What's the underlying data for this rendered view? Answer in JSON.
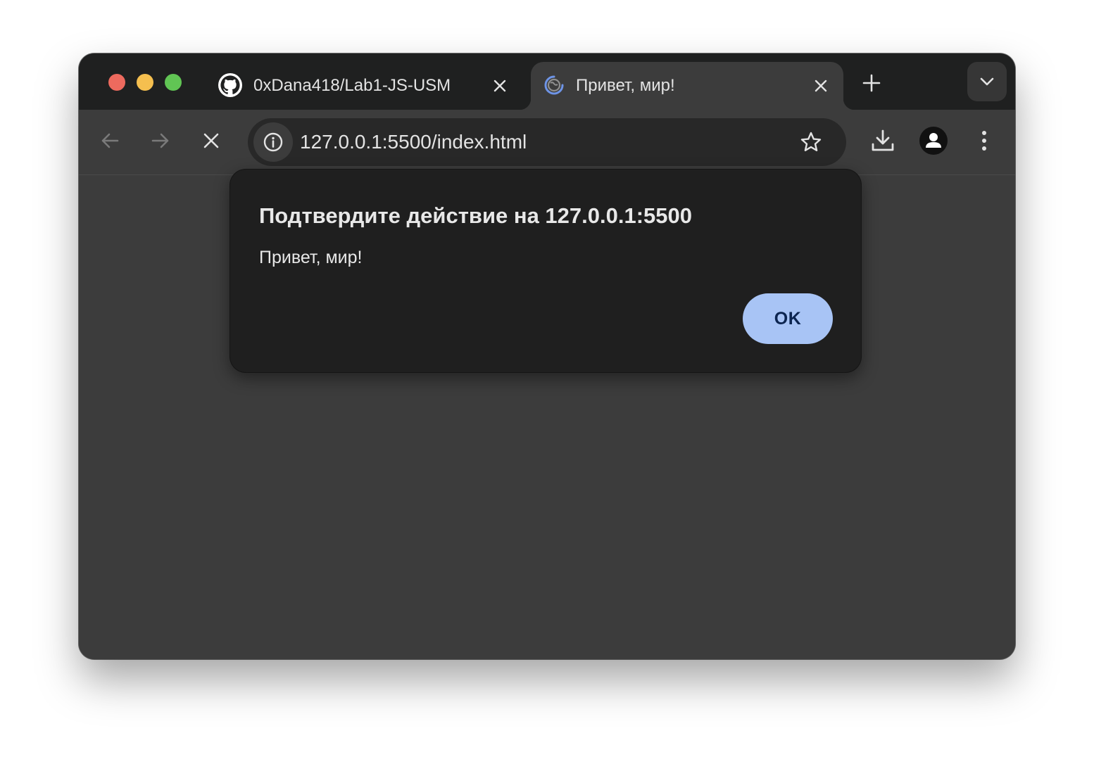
{
  "window": {
    "traffic_lights": [
      "close",
      "minimize",
      "maximize"
    ]
  },
  "tabs": [
    {
      "title": "0xDana418/Lab1-JS-USM",
      "favicon": "github-icon",
      "active": false
    },
    {
      "title": "Привет, мир!",
      "favicon": "loading-globe-icon",
      "active": true
    }
  ],
  "toolbar": {
    "back_icon": "back-arrow-icon",
    "forward_icon": "forward-arrow-icon",
    "stop_icon": "stop-loading-icon",
    "url": "127.0.0.1:5500/index.html",
    "site_info_icon": "info-icon",
    "bookmark_icon": "star-icon",
    "download_icon": "download-icon",
    "profile_icon": "profile-icon",
    "menu_icon": "kebab-menu-icon"
  },
  "dialog": {
    "title": "Подтвердите действие на 127.0.0.1:5500",
    "message": "Привет, мир!",
    "ok_label": "OK"
  },
  "colors": {
    "titlebar": "#1f2020",
    "toolbar": "#3c3c3c",
    "dialog_bg": "#1f1f1f",
    "ok_button": "#a8c4f5",
    "ok_text": "#0c2550"
  }
}
